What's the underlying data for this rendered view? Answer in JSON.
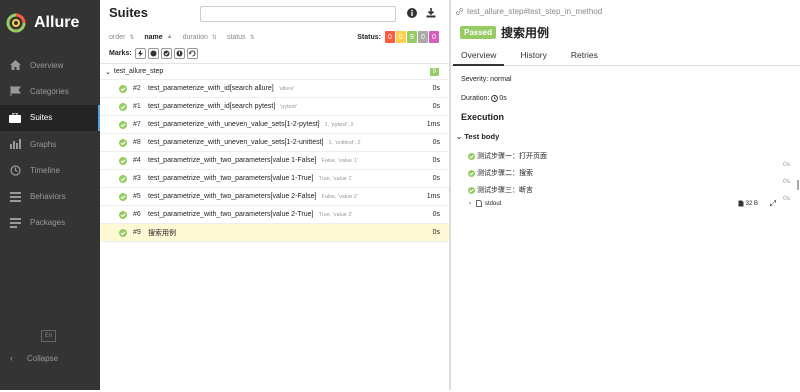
{
  "brand": {
    "title": "Allure"
  },
  "nav": [
    {
      "label": "Overview",
      "icon": "home-icon"
    },
    {
      "label": "Categories",
      "icon": "flag-icon"
    },
    {
      "label": "Suites",
      "icon": "briefcase-icon",
      "active": true
    },
    {
      "label": "Graphs",
      "icon": "bar-chart-icon"
    },
    {
      "label": "Timeline",
      "icon": "clock-icon"
    },
    {
      "label": "Behaviors",
      "icon": "list-icon"
    },
    {
      "label": "Packages",
      "icon": "packages-icon"
    }
  ],
  "sidebar_footer": {
    "lang": "En",
    "collapse": "Collapse"
  },
  "suites": {
    "title": "Suites",
    "search_placeholder": "",
    "sort": {
      "order": "order",
      "name": "name",
      "duration": "duration",
      "status": "status"
    },
    "status_label": "Status:",
    "status_counts": [
      {
        "value": "0",
        "color": "#fd5a3e"
      },
      {
        "value": "0",
        "color": "#ffd050"
      },
      {
        "value": "9",
        "color": "#97cc64"
      },
      {
        "value": "0",
        "color": "#aaaaaa"
      },
      {
        "value": "0",
        "color": "#d35ebe"
      }
    ],
    "marks_label": "Marks:",
    "group": {
      "name": "test_allure_step",
      "count": "9"
    },
    "rows": [
      {
        "num": "#2",
        "name": "test_parameterize_with_id[search allure]",
        "param": "'allure'",
        "dur": "0s"
      },
      {
        "num": "#1",
        "name": "test_parameterize_with_id[search pytest]",
        "param": "'pytest'",
        "dur": "0s"
      },
      {
        "num": "#7",
        "name": "test_parameterize_with_uneven_value_sets[1-2-pytest]",
        "param": "1, 'pytest', 2",
        "dur": "1ms"
      },
      {
        "num": "#8",
        "name": "test_parameterize_with_uneven_value_sets[1-2-unittest]",
        "param": "1, 'unittest', 2",
        "dur": "0s"
      },
      {
        "num": "#4",
        "name": "test_parametrize_with_two_parameters[value 1-False]",
        "param": "False, 'value 1'",
        "dur": "0s"
      },
      {
        "num": "#3",
        "name": "test_parametrize_with_two_parameters[value 1-True]",
        "param": "True, 'value 1'",
        "dur": "0s"
      },
      {
        "num": "#5",
        "name": "test_parametrize_with_two_parameters[value 2-False]",
        "param": "False, 'value 2'",
        "dur": "1ms"
      },
      {
        "num": "#6",
        "name": "test_parametrize_with_two_parameters[value 2-True]",
        "param": "True, 'value 2'",
        "dur": "0s"
      },
      {
        "num": "#9",
        "name": "搜索用例",
        "param": "",
        "dur": "0s",
        "selected": true
      }
    ]
  },
  "detail": {
    "breadcrumb": "test_allure_step#test_step_in_method",
    "status_badge": "Passed",
    "title": "搜索用例",
    "tabs": [
      "Overview",
      "History",
      "Retries"
    ],
    "severity": "Severity: normal",
    "duration_label": "Duration:",
    "duration_value": "0s",
    "execution": "Execution",
    "test_body": "Test body",
    "steps": [
      {
        "label": "测试步骤一：打开页面",
        "dur": "0s"
      },
      {
        "label": "测试步骤二：搜索",
        "dur": "0s"
      },
      {
        "label": "测试步骤三：断言",
        "dur": "0s"
      }
    ],
    "attachment": {
      "name": "stdout",
      "size": "32 B"
    }
  }
}
